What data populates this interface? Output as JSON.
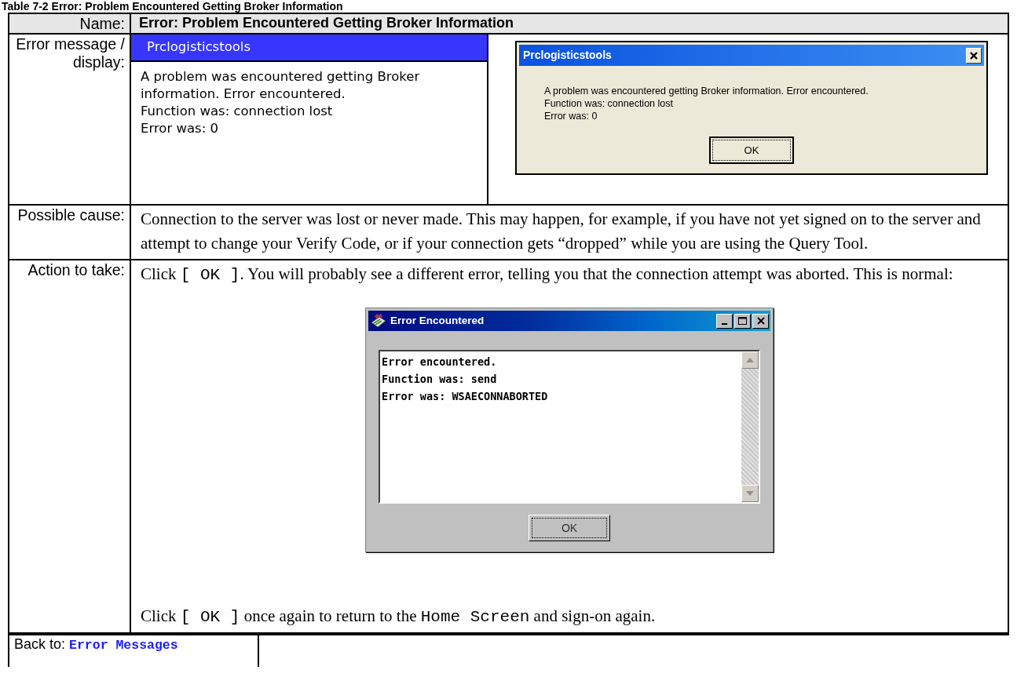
{
  "caption": "Table 7-2 Error: Problem Encountered Getting Broker Information",
  "name_row": {
    "label": "Name:",
    "value": "Error: Problem Encountered Getting Broker Information"
  },
  "message_row": {
    "label": "Error message / display:",
    "mockup": {
      "title": "Prclogisticstools",
      "lines": [
        "A problem was encountered getting Broker information. Error encountered.",
        "Function was: connection lost",
        "Error was: 0"
      ]
    },
    "dialog": {
      "title": "Prclogisticstools",
      "lines": [
        "A problem was encountered getting Broker information.  Error encountered.",
        "Function was: connection lost",
        "Error was: 0"
      ],
      "button": "OK"
    }
  },
  "cause_row": {
    "label": "Possible cause:",
    "text": "Connection to the server was lost or never made. This may happen, for example, if you have not yet signed on to the server and attempt to change your Verify Code, or if your connection gets “dropped” while you are using the Query Tool."
  },
  "action_row": {
    "label": "Action to take:",
    "intro": [
      {
        "kind": "plain",
        "text": "Click "
      },
      {
        "kind": "code",
        "text": "[ OK ]"
      },
      {
        "kind": "plain",
        "text": ". You will probably see a different error, telling you that the connection attempt was aborted. This is normal:"
      }
    ],
    "dialog": {
      "title": "Error Encountered",
      "lines": [
        "Error encountered.",
        "Function was: send",
        "Error was: WSAECONNABORTED"
      ],
      "button": "OK"
    },
    "outro": [
      {
        "kind": "plain",
        "text": "Click "
      },
      {
        "kind": "code",
        "text": "[ OK ]"
      },
      {
        "kind": "plain",
        "text": " once again to return to the "
      },
      {
        "kind": "code",
        "text": "Home Screen"
      },
      {
        "kind": "plain",
        "text": " and sign-on again."
      }
    ]
  },
  "back_row": {
    "label": "Back to:",
    "link": "Error Messages"
  }
}
